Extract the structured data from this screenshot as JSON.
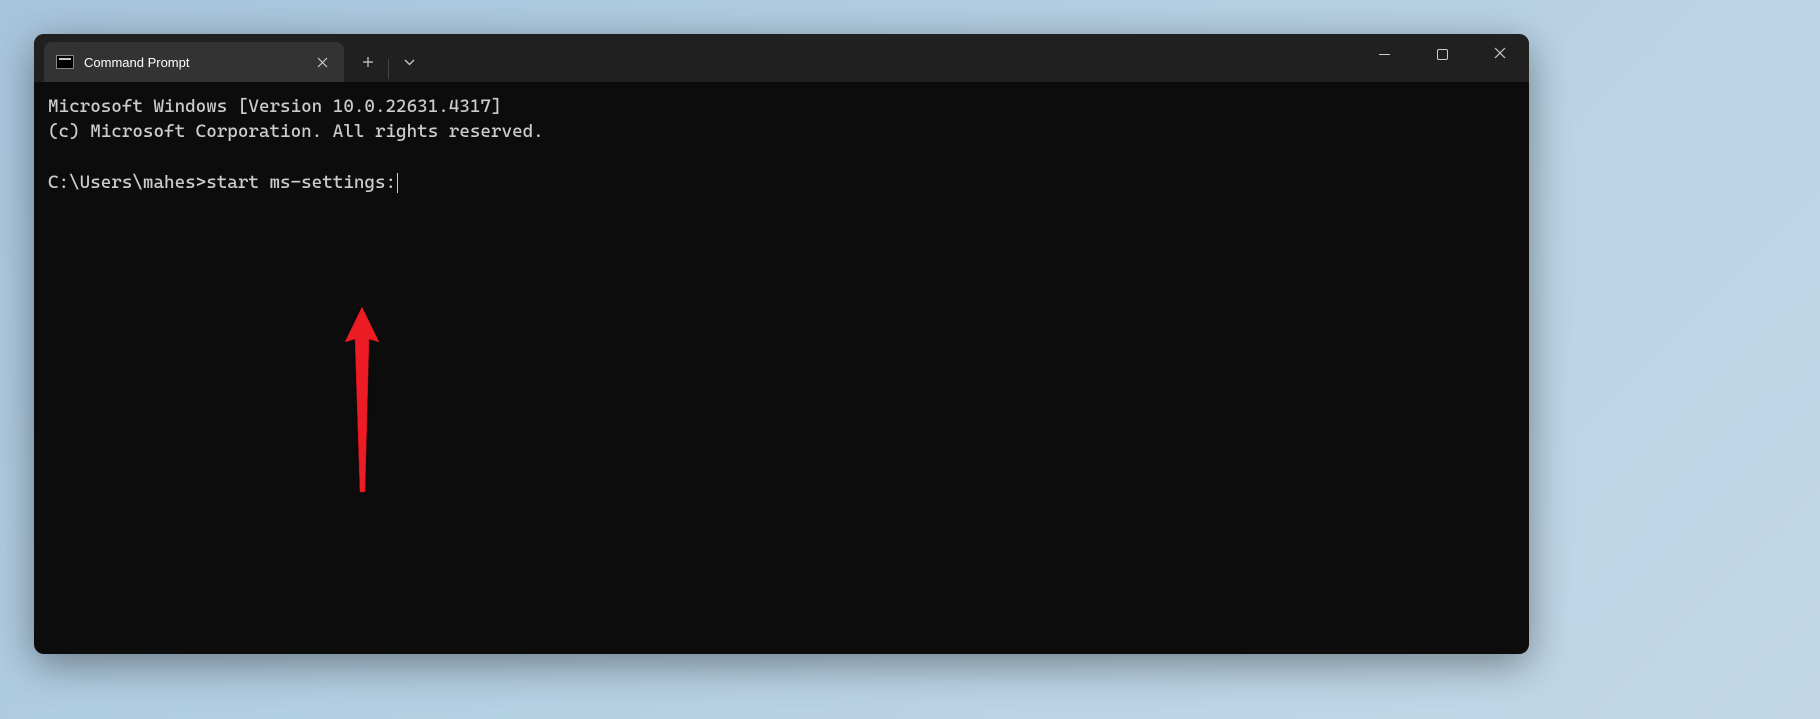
{
  "titlebar": {
    "tab_title": "Command Prompt"
  },
  "terminal": {
    "line1": "Microsoft Windows [Version 10.0.22631.4317]",
    "line2": "(c) Microsoft Corporation. All rights reserved.",
    "prompt": "C:\\Users\\mahes>",
    "command": "start ms-settings:"
  },
  "colors": {
    "arrow": "#ed1c24",
    "terminal_bg": "#0c0c0c",
    "titlebar_bg": "#202020",
    "tab_bg": "#333333",
    "text": "#cccccc"
  }
}
